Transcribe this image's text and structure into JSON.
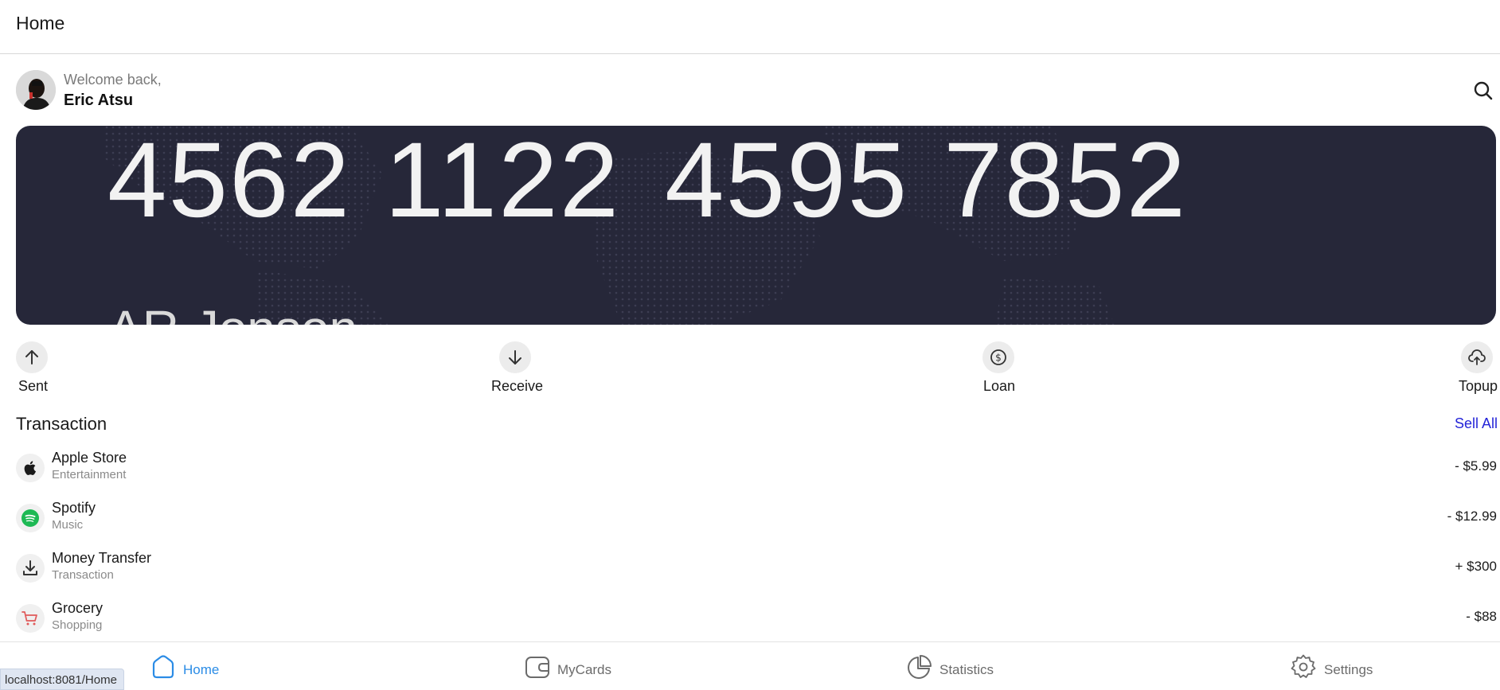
{
  "header": {
    "title": "Home"
  },
  "welcome": {
    "greeting": "Welcome back,",
    "name": "Eric Atsu"
  },
  "card": {
    "number_groups": [
      "4562",
      "1122",
      "4595",
      "7852"
    ],
    "holder": "AR Jonson",
    "background_color": "#262739"
  },
  "actions": [
    {
      "label": "Sent",
      "icon": "arrow-up-icon"
    },
    {
      "label": "Receive",
      "icon": "arrow-down-icon"
    },
    {
      "label": "Loan",
      "icon": "dollar-circle-icon"
    },
    {
      "label": "Topup",
      "icon": "cloud-upload-icon"
    }
  ],
  "transactions_section": {
    "title": "Transaction",
    "see_all": "Sell All"
  },
  "transactions": [
    {
      "name": "Apple Store",
      "category": "Entertainment",
      "amount": "- $5.99",
      "icon": "apple-icon"
    },
    {
      "name": "Spotify",
      "category": "Music",
      "amount": "- $12.99",
      "icon": "spotify-icon"
    },
    {
      "name": "Money Transfer",
      "category": "Transaction",
      "amount": "+ $300",
      "icon": "download-icon"
    },
    {
      "name": "Grocery",
      "category": "Shopping",
      "amount": "- $88",
      "icon": "cart-icon"
    }
  ],
  "nav": {
    "items": [
      {
        "label": "Home",
        "icon": "home-icon",
        "active": true
      },
      {
        "label": "MyCards",
        "icon": "wallet-icon",
        "active": false
      },
      {
        "label": "Statistics",
        "icon": "pie-chart-icon",
        "active": false
      },
      {
        "label": "Settings",
        "icon": "gear-icon",
        "active": false
      }
    ],
    "active_color": "#2b8ce6",
    "inactive_color": "#6b6b6b"
  },
  "status_bar": {
    "url": "localhost:8081/Home"
  }
}
